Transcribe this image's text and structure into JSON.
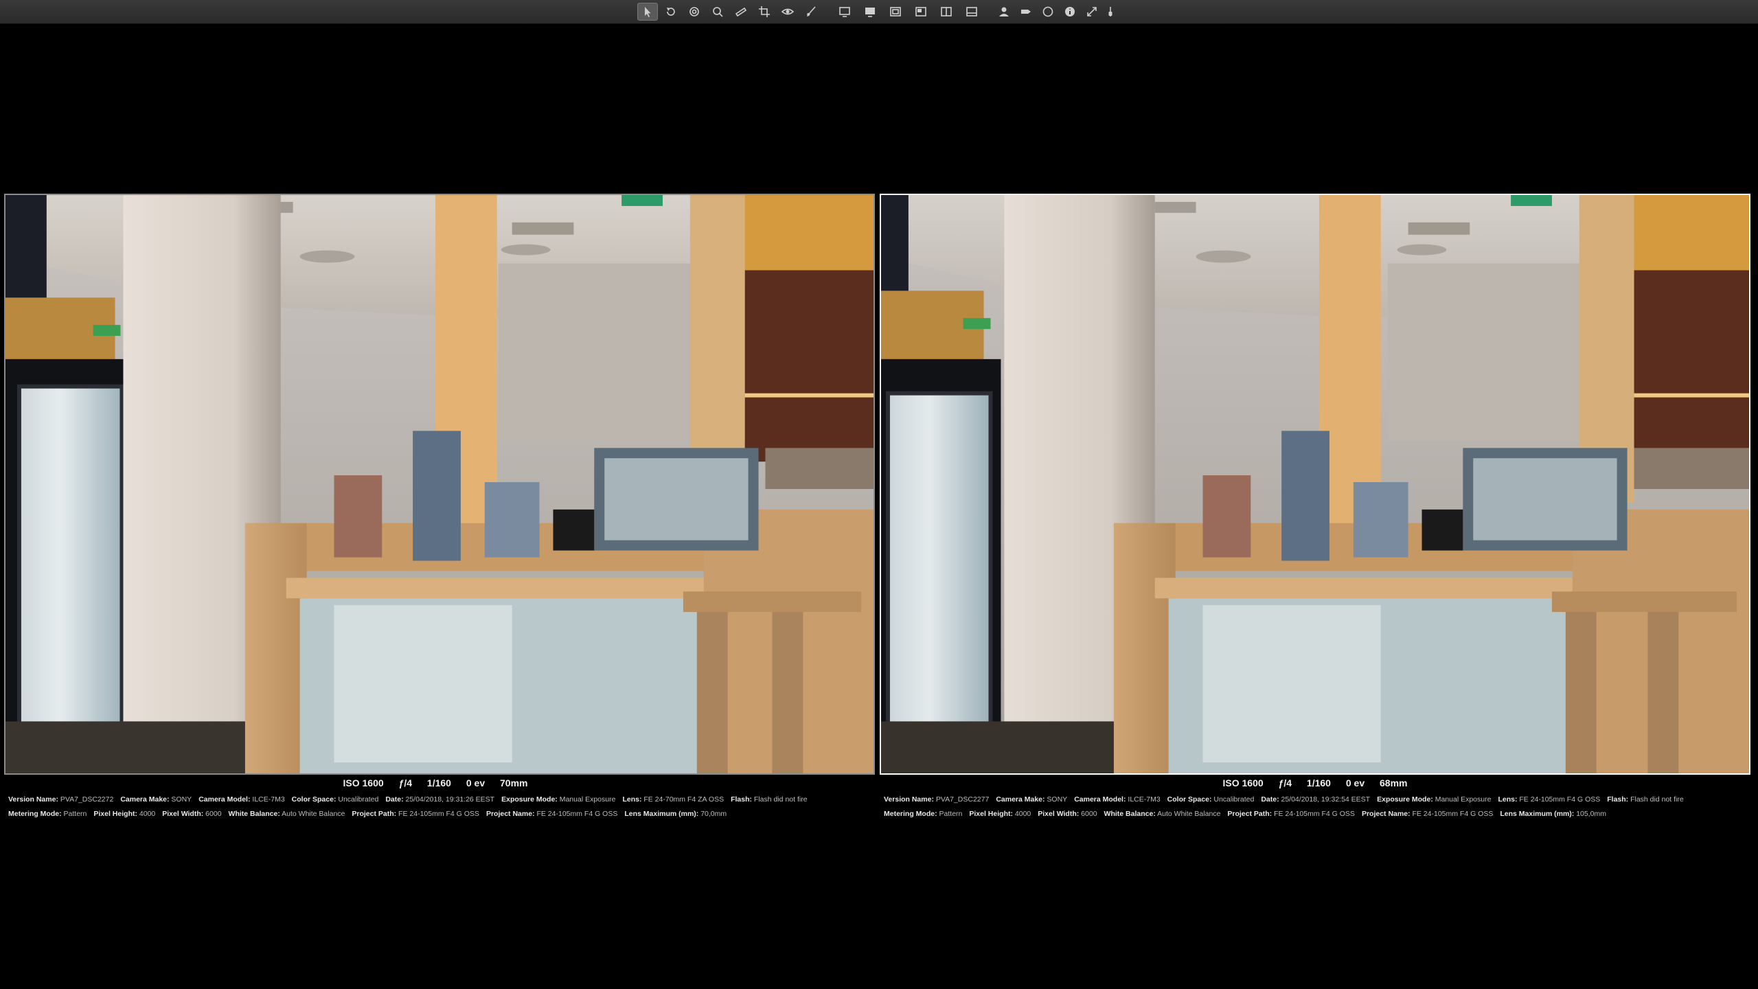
{
  "toolbar": {
    "tools": [
      {
        "name": "select-tool-icon",
        "active": true
      },
      {
        "name": "rotate-tool-icon"
      },
      {
        "name": "loupe-tool-icon"
      },
      {
        "name": "zoom-tool-icon"
      },
      {
        "name": "straighten-tool-icon"
      },
      {
        "name": "crop-tool-icon"
      },
      {
        "name": "red-eye-tool-icon"
      },
      {
        "name": "brush-tool-icon"
      },
      {
        "name": "viewer-mode-icon"
      },
      {
        "name": "browser-mode-icon"
      },
      {
        "name": "split-view-icon"
      },
      {
        "name": "stacked-view-icon"
      },
      {
        "name": "compare-view-icon"
      },
      {
        "name": "multi-view-icon"
      },
      {
        "name": "faces-icon"
      },
      {
        "name": "label-icon"
      },
      {
        "name": "circle-icon"
      },
      {
        "name": "info-icon"
      },
      {
        "name": "fullscreen-icon"
      },
      {
        "name": "slider-icon"
      }
    ]
  },
  "left": {
    "caption": {
      "iso": "ISO 1600",
      "aperture": "ƒ/4",
      "shutter": "1/160",
      "ev": "0 ev",
      "focal": "70mm"
    },
    "meta_row1": [
      {
        "k": "Version Name:",
        "v": "PVA7_DSC2272"
      },
      {
        "k": "Camera Make:",
        "v": "SONY"
      },
      {
        "k": "Camera Model:",
        "v": "ILCE-7M3"
      },
      {
        "k": "Color Space:",
        "v": "Uncalibrated"
      },
      {
        "k": "Date:",
        "v": "25/04/2018, 19:31:26 EEST"
      },
      {
        "k": "Exposure Mode:",
        "v": "Manual Exposure"
      },
      {
        "k": "Lens:",
        "v": "FE 24-70mm F4 ZA OSS"
      },
      {
        "k": "Flash:",
        "v": "Flash did not fire"
      }
    ],
    "meta_row2": [
      {
        "k": "Metering Mode:",
        "v": "Pattern"
      },
      {
        "k": "Pixel Height:",
        "v": "4000"
      },
      {
        "k": "Pixel Width:",
        "v": "6000"
      },
      {
        "k": "White Balance:",
        "v": "Auto White Balance"
      },
      {
        "k": "Project Path:",
        "v": "FE 24-105mm F4 G OSS"
      },
      {
        "k": "Project Name:",
        "v": "FE 24-105mm F4 G OSS"
      },
      {
        "k": "Lens Maximum (mm):",
        "v": "70,0mm"
      }
    ]
  },
  "right": {
    "caption": {
      "iso": "ISO 1600",
      "aperture": "ƒ/4",
      "shutter": "1/160",
      "ev": "0 ev",
      "focal": "68mm"
    },
    "meta_row1": [
      {
        "k": "Version Name:",
        "v": "PVA7_DSC2277"
      },
      {
        "k": "Camera Make:",
        "v": "SONY"
      },
      {
        "k": "Camera Model:",
        "v": "ILCE-7M3"
      },
      {
        "k": "Color Space:",
        "v": "Uncalibrated"
      },
      {
        "k": "Date:",
        "v": "25/04/2018, 19:32:54 EEST"
      },
      {
        "k": "Exposure Mode:",
        "v": "Manual Exposure"
      },
      {
        "k": "Lens:",
        "v": "FE 24-105mm F4 G OSS"
      },
      {
        "k": "Flash:",
        "v": "Flash did not fire"
      }
    ],
    "meta_row2": [
      {
        "k": "Metering Mode:",
        "v": "Pattern"
      },
      {
        "k": "Pixel Height:",
        "v": "4000"
      },
      {
        "k": "Pixel Width:",
        "v": "6000"
      },
      {
        "k": "White Balance:",
        "v": "Auto White Balance"
      },
      {
        "k": "Project Path:",
        "v": "FE 24-105mm F4 G OSS"
      },
      {
        "k": "Project Name:",
        "v": "FE 24-105mm F4 G OSS"
      },
      {
        "k": "Lens Maximum (mm):",
        "v": "105,0mm"
      }
    ]
  }
}
